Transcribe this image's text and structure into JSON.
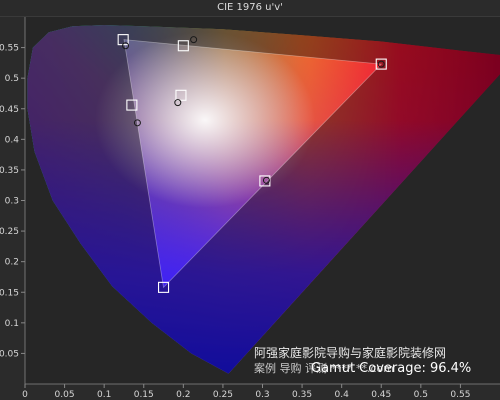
{
  "chart_data": {
    "type": "scatter",
    "title": "CIE 1976 u'v'",
    "xlim": [
      0,
      0.6
    ],
    "ylim": [
      0,
      0.6
    ],
    "x_ticks": [
      "0",
      "0.05",
      "0.1",
      "0.15",
      "0.2",
      "0.25",
      "0.3",
      "0.35",
      "0.4",
      "0.45",
      "0.5",
      "0.55"
    ],
    "y_ticks": [
      "0",
      "0.05",
      "0.1",
      "0.15",
      "0.2",
      "0.25",
      "0.3",
      "0.35",
      "0.4",
      "0.45",
      "0.5",
      "0.55"
    ],
    "target_gamut": [
      {
        "u": 0.45,
        "v": 0.523
      },
      {
        "u": 0.125,
        "v": 0.563
      },
      {
        "u": 0.175,
        "v": 0.158
      }
    ],
    "measured_points": [
      {
        "u": 0.45,
        "v": 0.523
      },
      {
        "u": 0.127,
        "v": 0.553
      },
      {
        "u": 0.213,
        "v": 0.563
      },
      {
        "u": 0.142,
        "v": 0.427
      },
      {
        "u": 0.193,
        "v": 0.46
      },
      {
        "u": 0.305,
        "v": 0.333
      }
    ],
    "target_squares": [
      {
        "u": 0.45,
        "v": 0.523
      },
      {
        "u": 0.124,
        "v": 0.563
      },
      {
        "u": 0.2,
        "v": 0.553
      },
      {
        "u": 0.135,
        "v": 0.456
      },
      {
        "u": 0.197,
        "v": 0.472
      },
      {
        "u": 0.303,
        "v": 0.332
      },
      {
        "u": 0.175,
        "v": 0.158
      }
    ],
    "grid": false,
    "annotation": "Gamut Coverage: 96.4%"
  },
  "watermark": {
    "line1": "阿强家庭影院导购与家庭影院装修网",
    "line2": "案例  导购  评测  ****.**.com"
  }
}
